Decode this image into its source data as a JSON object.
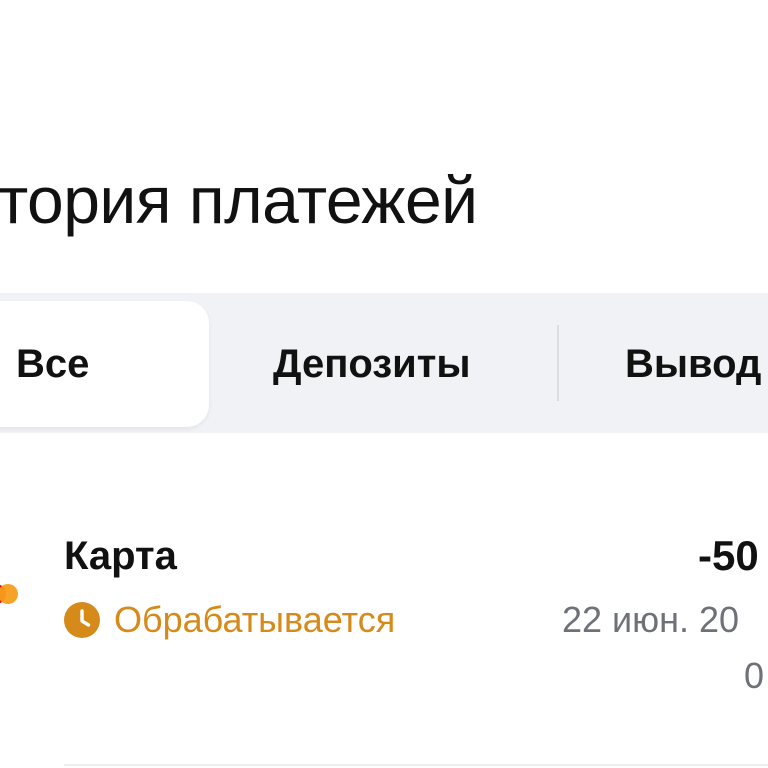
{
  "header": {
    "title": "тория платежей"
  },
  "tabs": [
    {
      "label": "Все",
      "selected": true
    },
    {
      "label": "Депозиты",
      "selected": false
    },
    {
      "label": "Вывод",
      "selected": false
    }
  ],
  "transactions": [
    {
      "method": "Карта",
      "method_icon": "mastercard-logo-icon",
      "status": "Обрабатывается",
      "status_icon": "clock-icon",
      "amount": "-50",
      "date": "22 июн. 20",
      "time": "0"
    }
  ],
  "colors": {
    "tab_bar_background": "#f1f2f6",
    "selected_tab_background": "#ffffff",
    "status_pending": "#d68a1a",
    "secondary_text": "#6f7178",
    "mastercard_red": "#eb001b",
    "mastercard_orange": "#f79e1b"
  }
}
